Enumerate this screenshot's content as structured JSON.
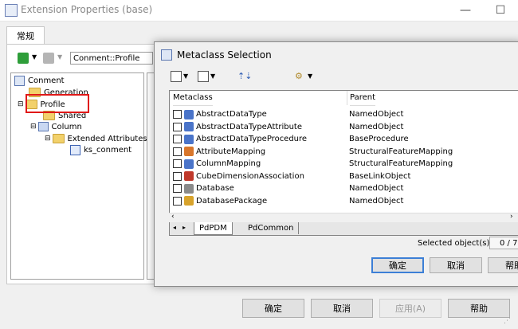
{
  "window": {
    "title": "Extension Properties (base)",
    "minimize": "—",
    "maximize": "☐",
    "close": "✕"
  },
  "tabs": {
    "general": "常规"
  },
  "combo": {
    "value": "Conment::Profile"
  },
  "tree": {
    "items": [
      {
        "label": "Conment"
      },
      {
        "label": "Generation"
      },
      {
        "label": "Profile"
      },
      {
        "label": "Shared"
      },
      {
        "label": "Column"
      },
      {
        "label": "Extended Attributes"
      },
      {
        "label": "ks_conment"
      }
    ]
  },
  "main_buttons": {
    "ok": "确定",
    "cancel": "取消",
    "apply": "应用(A)",
    "help": "帮助"
  },
  "dialog": {
    "title": "Metaclass Selection",
    "columns": {
      "metaclass": "Metaclass",
      "parent": "Parent"
    },
    "rows": [
      {
        "name": "AbstractDataType",
        "parent": "NamedObject",
        "color": "#4a74c9"
      },
      {
        "name": "AbstractDataTypeAttribute",
        "parent": "NamedObject",
        "color": "#4a74c9"
      },
      {
        "name": "AbstractDataTypeProcedure",
        "parent": "BaseProcedure",
        "color": "#4a74c9"
      },
      {
        "name": "AttributeMapping",
        "parent": "StructuralFeatureMapping",
        "color": "#d8762b"
      },
      {
        "name": "ColumnMapping",
        "parent": "StructuralFeatureMapping",
        "color": "#4a74c9"
      },
      {
        "name": "CubeDimensionAssociation",
        "parent": "BaseLinkObject",
        "color": "#c0392b"
      },
      {
        "name": "Database",
        "parent": "NamedObject",
        "color": "#8a8a8a"
      },
      {
        "name": "DatabasePackage",
        "parent": "NamedObject",
        "color": "#d8a32b"
      }
    ],
    "bottom_tabs": {
      "tab1": "PdPDM",
      "tab2": "PdCommon"
    },
    "selected_label": "Selected object(s):",
    "selected_count": "0 / 7",
    "buttons": {
      "ok": "确定",
      "cancel": "取消",
      "help": "帮助"
    }
  }
}
